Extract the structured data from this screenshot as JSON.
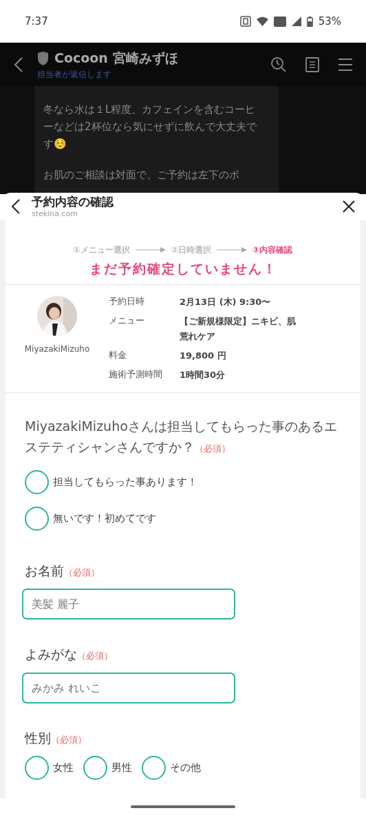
{
  "status_bar": {
    "time": "7:37",
    "battery": "53%"
  },
  "chat": {
    "title": "Cocoon 宮崎みずほ",
    "subtitle": "担当者が返信します",
    "messages": [
      "冬なら水は１L程度、カフェインを含むコーヒーなどは2杯位なら気にせずに飲んで大丈夫です☺️",
      "お肌のご相談は対面で、ご予約は左下のボ"
    ]
  },
  "sheet": {
    "title": "予約内容の確認",
    "url": "stekina.com"
  },
  "steps": [
    {
      "label": "①メニュー選択",
      "selected": false
    },
    {
      "label": "②日時選択",
      "selected": false
    },
    {
      "label": "③内容確認",
      "selected": true
    }
  ],
  "warning": "まだ予約確定していません！",
  "stylist": {
    "name": "MiyazakiMizuho"
  },
  "details": [
    {
      "label": "予約日時",
      "value": "2月13日 (木) 9:30〜"
    },
    {
      "label": "メニュー",
      "value": "【ご新規様限定】ニキビ、肌荒れケア"
    },
    {
      "label": "料金",
      "value": "19,800 円"
    },
    {
      "label": "施術予測時間",
      "value": "1時間30分"
    }
  ],
  "question": {
    "text": "MiyazakiMizuhoさんは担当してもらった事のあるエステティシャンさんですか？",
    "required": "（必須）",
    "options": [
      {
        "label": "担当してもらった事あります！",
        "selected": false
      },
      {
        "label": "無いです！初めてです",
        "selected": false
      }
    ]
  },
  "fields": [
    {
      "label": "お名前",
      "required": "（必須）",
      "placeholder": "美髪 麗子"
    },
    {
      "label": "よみがな",
      "required": "（必須）",
      "placeholder": "みかみ れいこ"
    }
  ],
  "gender": {
    "label": "性別",
    "required": "（必須）",
    "options": [
      {
        "label": "女性",
        "selected": false
      },
      {
        "label": "男性",
        "selected": false
      },
      {
        "label": "その他",
        "selected": false
      }
    ]
  }
}
